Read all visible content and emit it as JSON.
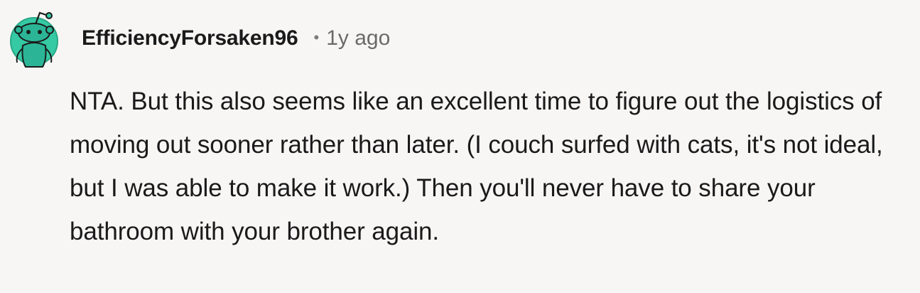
{
  "comment": {
    "username": "EfficiencyForsaken96",
    "separator": "•",
    "timestamp": "1y ago",
    "avatar": {
      "icon": "snoo-avatar-icon",
      "bg_color": "#2bb596"
    },
    "text": "NTA. But this also seems like an excellent time to figure out the logistics of moving out sooner rather than later. (I couch surfed with cats, it's not ideal, but I was able to make it work.) Then you'll never have to share your bathroom with your brother again."
  }
}
